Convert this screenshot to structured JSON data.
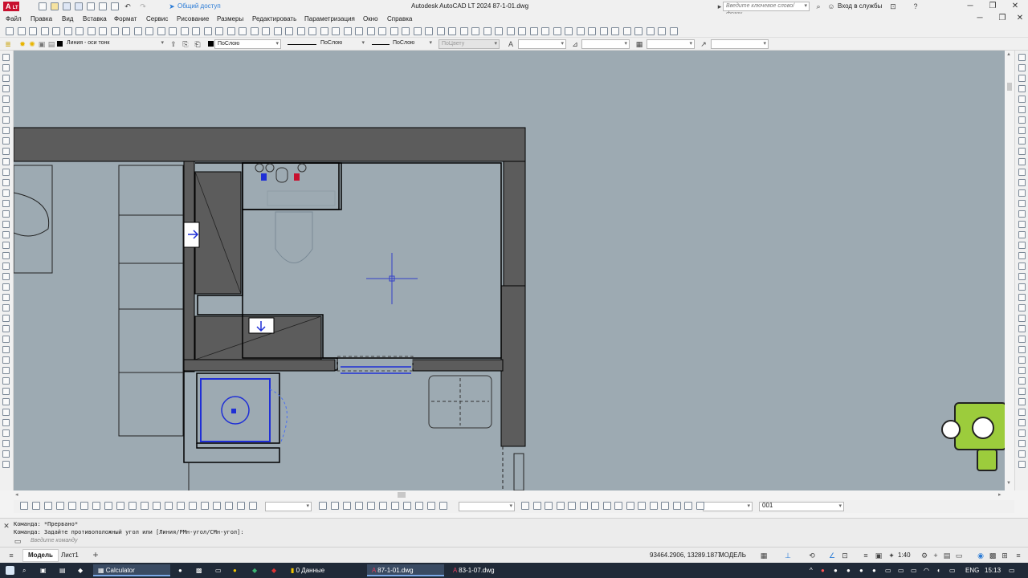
{
  "titlebar": {
    "app_logo": "A",
    "app_badge": "LT",
    "share_label": "Общий доступ",
    "title": "Autodesk AutoCAD LT 2024    87-1-01.dwg",
    "search_placeholder": "Введите ключевое слово/фразу",
    "signin_label": "Вход в службы"
  },
  "menu": [
    "Файл",
    "Правка",
    "Вид",
    "Вставка",
    "Формат",
    "Сервис",
    "Рисование",
    "Размеры",
    "Редактировать",
    "Параметризация",
    "Окно",
    "Справка"
  ],
  "properties_bar": {
    "layer": "Линия - оси тонк",
    "color": "ПоСлою",
    "linetype": "ПоСлою",
    "lineweight": "ПоСлою",
    "plotstyle": "ПоЦвету"
  },
  "bottom_toolbar": {
    "scale_value": "001"
  },
  "command": {
    "line1": "Команда: *Прервано*",
    "line2": "Команда: Задайте противоположный угол или [Линия/РМн-угол/СМн-угол]:",
    "placeholder": "Введите команду"
  },
  "status": {
    "tabs": [
      "Модель",
      "Лист1"
    ],
    "coordinates": "93464.2906, 13289.1877",
    "mode": "МОДЕЛЬ",
    "scale": "1:40"
  },
  "taskbar": {
    "apps": [
      {
        "label": "Calculator",
        "icon": "calculator-icon"
      },
      {
        "label": "0 Данные",
        "icon": "folder-icon"
      },
      {
        "label": "87-1-01.dwg",
        "icon": "autocad-icon"
      },
      {
        "label": "83-1-07.dwg",
        "icon": "autocad-icon"
      }
    ],
    "lang": "ENG",
    "time": "15:13"
  },
  "colors": {
    "canvas": "#9daab2",
    "wall": "#5a5a5a",
    "accent_blue": "#1f2fd6",
    "autocad_red": "#c8102e",
    "taskbar": "#202a38"
  }
}
